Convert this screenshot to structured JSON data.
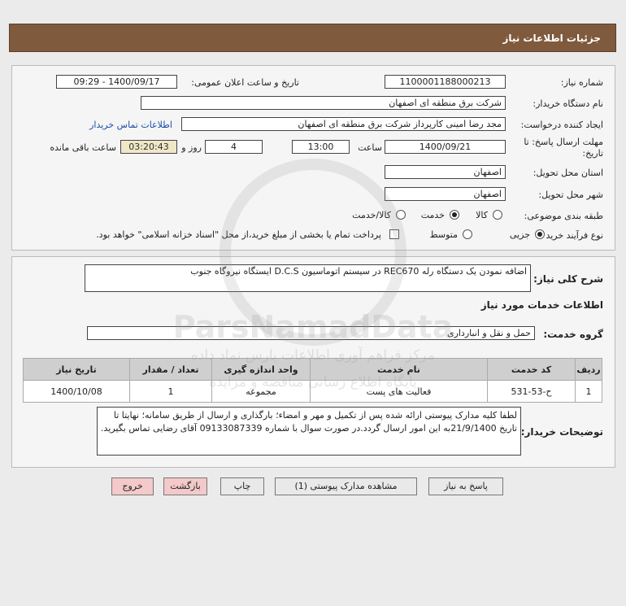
{
  "header": {
    "title": "جزئیات اطلاعات نیاز"
  },
  "form": {
    "need_number_label": "شماره نیاز:",
    "need_number": "1100001188000213",
    "announce_label": "تاریخ و ساعت اعلان عمومی:",
    "announce_value": "1400/09/17 - 09:29",
    "buyer_org_label": "نام دستگاه خریدار:",
    "buyer_org": "شرکت برق منطقه ای اصفهان",
    "creator_label": "ایجاد کننده درخواست:",
    "creator": "مجد رضا امینی کارپرداز شرکت برق منطقه ای اصفهان",
    "contact_link": "اطلاعات تماس خریدار",
    "deadline_label_1": "مهلت ارسال پاسخ: تا",
    "deadline_label_2": "تاریخ:",
    "deadline_date": "1400/09/21",
    "time_label": "ساعت",
    "deadline_time": "13:00",
    "days_value": "4",
    "days_label": "روز و",
    "remaining_time": "03:20:43",
    "remaining_label": "ساعت باقی مانده",
    "province_label": "استان محل تحویل:",
    "province": "اصفهان",
    "city_label": "شهر محل تحویل:",
    "city": "اصفهان",
    "category_label": "طبقه بندی موضوعی:",
    "category_options": [
      "کالا",
      "خدمت",
      "کالا/خدمت"
    ],
    "category_selected": "خدمت",
    "process_label": "نوع فرآیند خرید :",
    "process_options": [
      "جزیی",
      "متوسط"
    ],
    "process_selected": "جزیی",
    "payment_note": "پرداخت تمام یا بخشی از مبلغ خرید،از محل \"اسناد خزانه اسلامی\" خواهد بود."
  },
  "details": {
    "summary_label": "شرح کلی نیاز:",
    "summary": "اضافه نمودن یک دستگاه رله REC670 در سیستم اتوماسیون D.C.S ایستگاه نیروگاه جنوب",
    "services_heading": "اطلاعات خدمات مورد نیاز",
    "service_group_label": "گروه خدمت:",
    "service_group": "حمل و نقل و انبارداری",
    "table": {
      "headers": [
        "ردیف",
        "کد خدمت",
        "نام خدمت",
        "واحد اندازه گیری",
        "تعداد / مقدار",
        "تاریخ نیاز"
      ],
      "rows": [
        [
          "1",
          "ح-53-531",
          "فعالیت های پست",
          "مجموعه",
          "1",
          "1400/10/08"
        ]
      ]
    },
    "buyer_notes_label": "توضیحات خریدار:",
    "buyer_notes": "لطفا کلیه مدارک پیوستی ارائه شده  پس از تکمیل و مهر و امضاء؛ بارگذاری و ارسال از طریق سامانه؛ نهایتا تا تاریخ 21/9/1400به این امور ارسال گردد.در صورت سوال با شماره 09133087339 آقای رضایی تماس بگیرید."
  },
  "buttons": {
    "reply": "پاسخ به نیاز",
    "attachments": "مشاهده مدارک پیوستی (1)",
    "print": "چاپ",
    "back": "بازگشت",
    "exit": "خروج"
  },
  "watermark": {
    "brand": "ParsNamadData",
    "line1": "مرکز فراهم آوری اطلاعات پارس نماد داده",
    "line2": "پایگاه اطلاع رسانی مناقصه و مزایده"
  }
}
